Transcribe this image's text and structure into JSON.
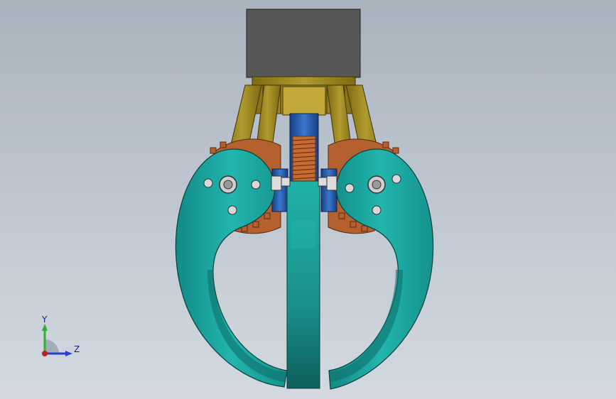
{
  "viewport": {
    "background_top": "#a9b3be",
    "background_bottom": "#d3d9df"
  },
  "model": {
    "colors": {
      "body": "#1aa6a0",
      "body_dark": "#0f6f6b",
      "housing": "#5a5a5a",
      "bracket": "#9a8520",
      "gear": "#b4612f",
      "spring": "#2a5fb0",
      "coil": "#c86a34"
    }
  },
  "triad": {
    "axis_y": "Y",
    "axis_z": "Z",
    "y_color": "#2fb02f",
    "z_color": "#2a3fd0",
    "x_color": "#c02020"
  }
}
